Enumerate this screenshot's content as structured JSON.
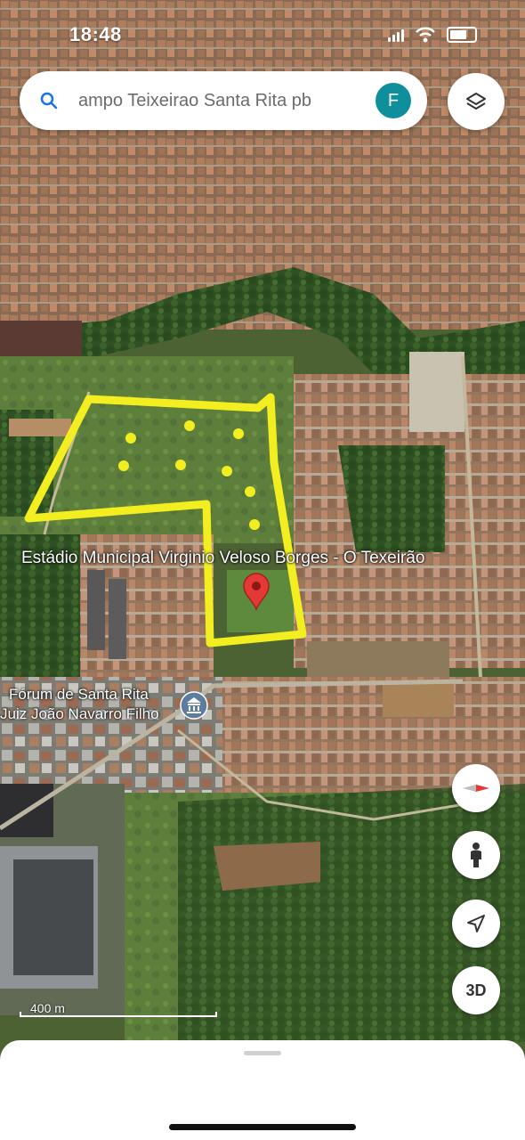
{
  "status": {
    "time": "18:48"
  },
  "search": {
    "query": "ampo Teixeirao Santa Rita pb",
    "avatar_letter": "F"
  },
  "labels": {
    "stadium": "Estádio Municipal Virginio Veloso Borges - O Texeirão",
    "forum_line1": "Fórum de Santa Rita",
    "forum_line2": "Juiz João Navarro Filho"
  },
  "scale": {
    "label": "400 m"
  },
  "buttons": {
    "three_d": "3D"
  },
  "icons": {
    "search": "search-icon",
    "layers": "layers-icon",
    "compass": "compass-icon",
    "street_view": "pegman-icon",
    "location": "navigation-arrow-icon",
    "pin": "place-pin-icon",
    "courthouse": "courthouse-icon"
  },
  "colors": {
    "highlight": "#f2ee1f",
    "pin": "#e53935",
    "avatar": "#0e8f9b",
    "search_icon": "#1a73e8"
  }
}
